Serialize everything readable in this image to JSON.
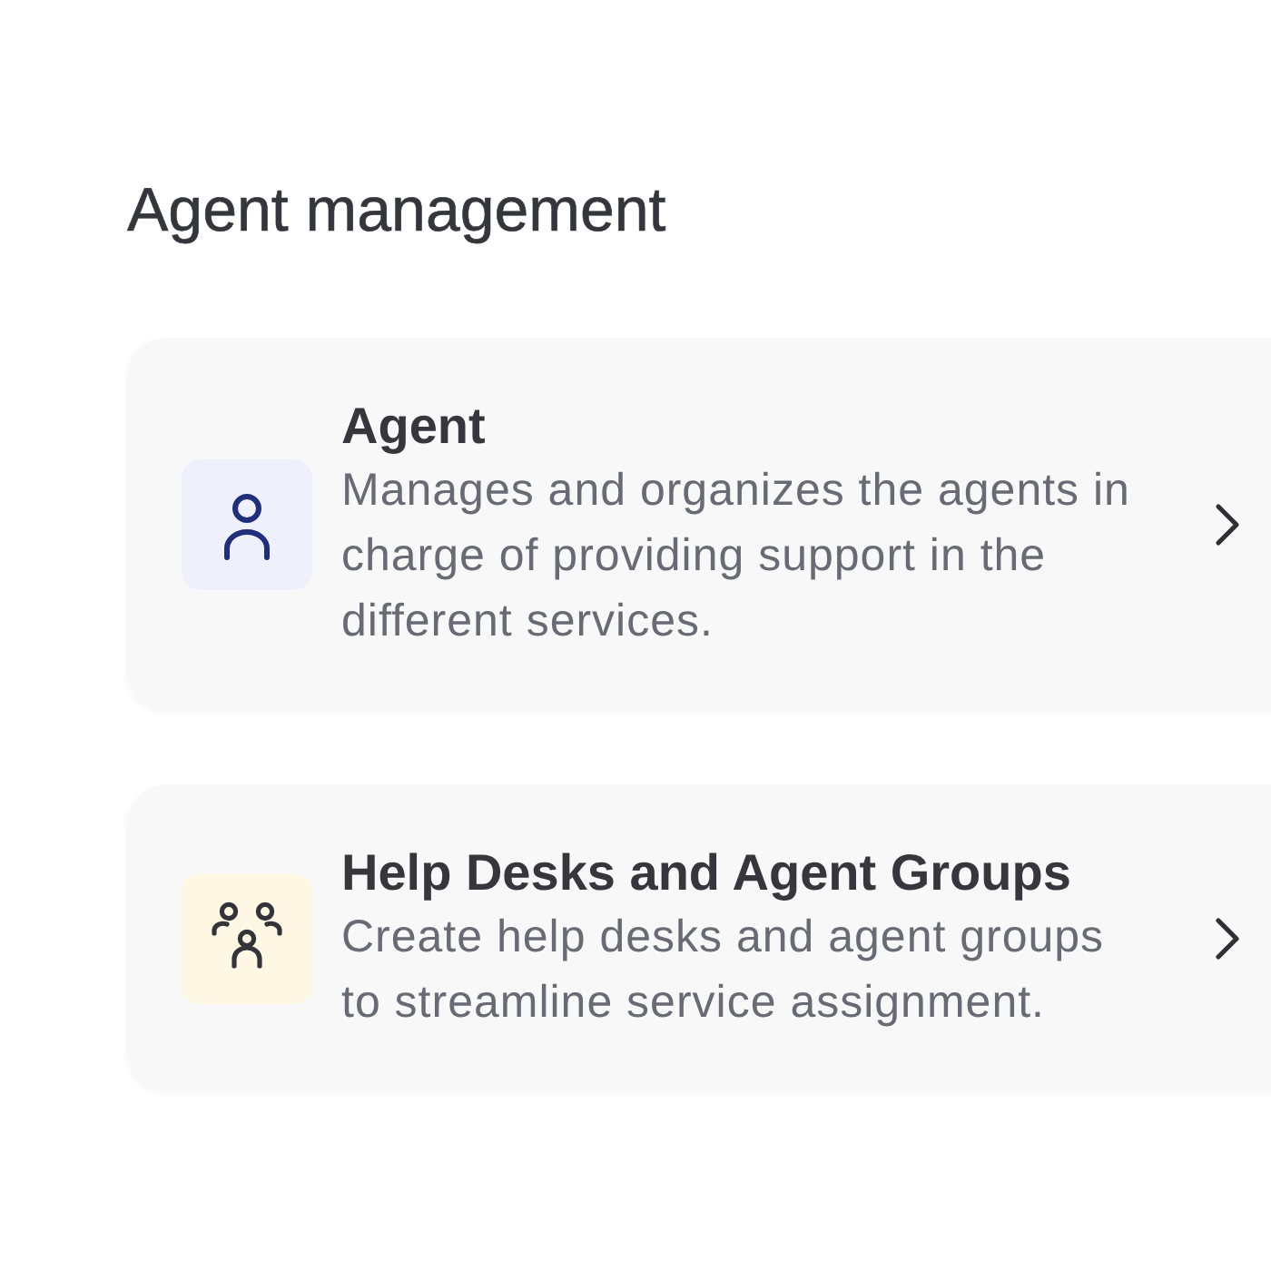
{
  "heading": "Agent management",
  "cards": [
    {
      "kind": "person",
      "color": "#eef0fb",
      "title": "Agent",
      "description": "Manages and organizes the agents in charge of providing support in the different services."
    },
    {
      "kind": "group",
      "color": "#fdf7e4",
      "title": "Help Desks and Agent Groups",
      "description": "Create help desks and agent groups to streamline service assignment."
    }
  ]
}
